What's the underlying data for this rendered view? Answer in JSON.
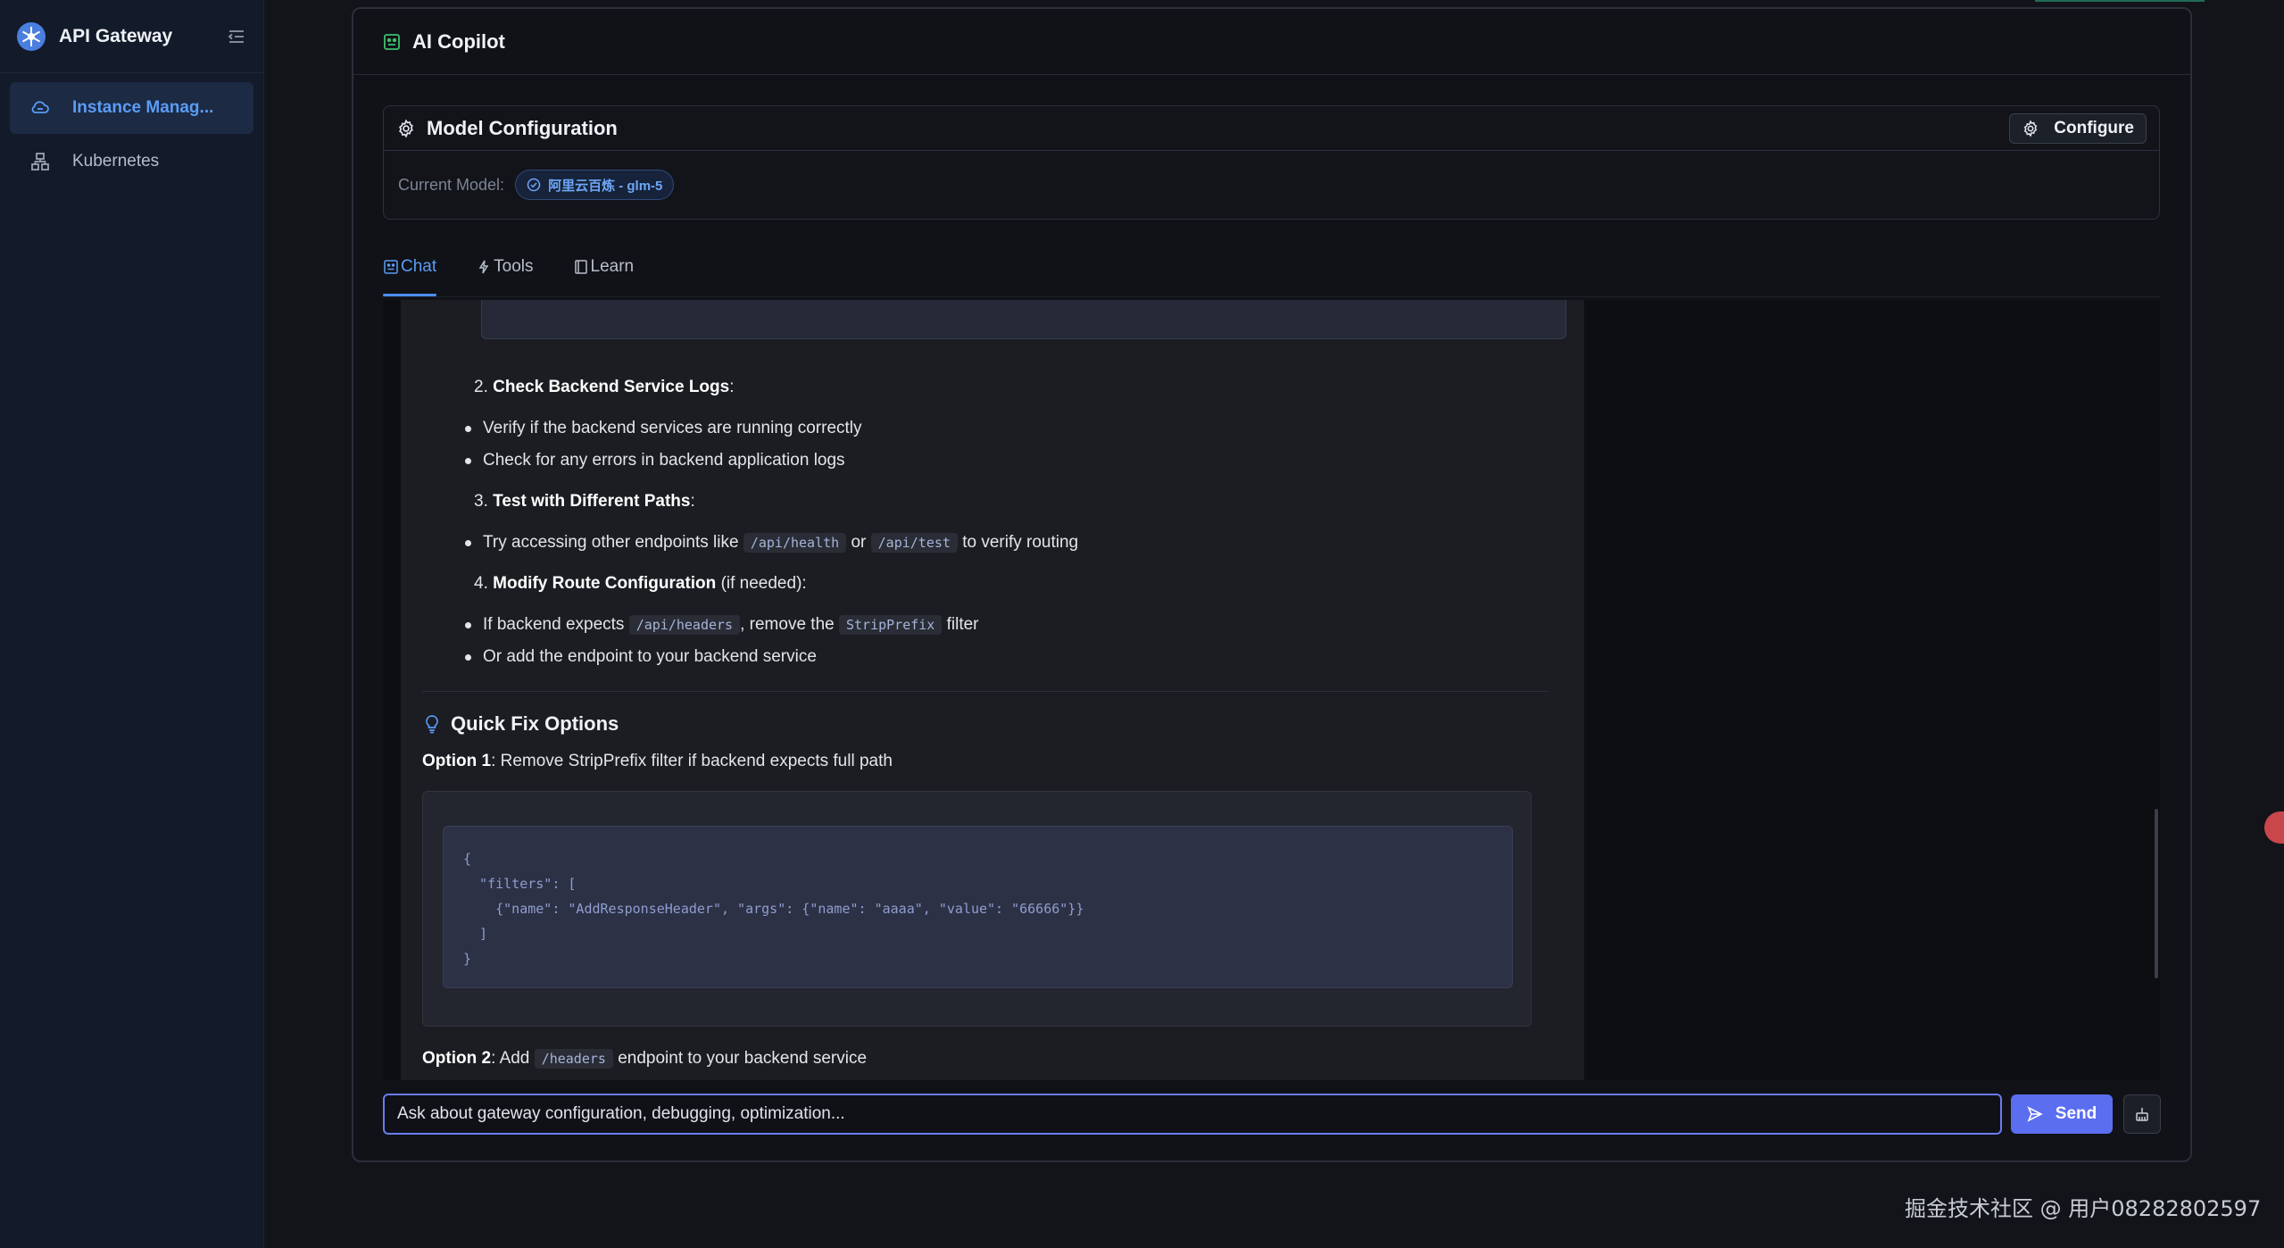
{
  "sidebar": {
    "brand": "API Gateway",
    "items": [
      {
        "label": "Instance Manag...",
        "active": true
      },
      {
        "label": "Kubernetes",
        "active": false
      }
    ]
  },
  "panel": {
    "title": "AI Copilot"
  },
  "model_config": {
    "title": "Model Configuration",
    "configure_label": "Configure",
    "current_label": "Current Model:",
    "current_model": "阿里云百炼 - glm-5"
  },
  "tabs": [
    {
      "label": "Chat",
      "active": true
    },
    {
      "label": "Tools",
      "active": false
    },
    {
      "label": "Learn",
      "active": false
    }
  ],
  "message": {
    "step2": {
      "num": "2.",
      "title": "Check Backend Service Logs",
      "suffix": ":"
    },
    "step2_bullets": [
      "Verify if the backend services are running correctly",
      "Check for any errors in backend application logs"
    ],
    "step3": {
      "num": "3.",
      "title": "Test with Different Paths",
      "suffix": ":"
    },
    "step3_bullet": {
      "pre": "Try accessing other endpoints like",
      "code1": "/api/health",
      "mid": "or",
      "code2": "/api/test",
      "post": "to verify routing"
    },
    "step4": {
      "num": "4.",
      "title": "Modify Route Configuration",
      "suffix": "(if needed):"
    },
    "step4_bullet1": {
      "pre": "If backend expects",
      "code1": "/api/headers",
      "mid": ", remove the",
      "code2": "StripPrefix",
      "post": "filter"
    },
    "step4_bullet2": "Or add the endpoint to your backend service",
    "quick_fix_title": "Quick Fix Options",
    "option1": {
      "label": "Option 1",
      "text": ": Remove StripPrefix filter if backend expects full path"
    },
    "code_lines": [
      "{",
      "  \"filters\": [",
      "    {\"name\": \"AddResponseHeader\", \"args\": {\"name\": \"aaaa\", \"value\": \"66666\"}}",
      "  ]",
      "}"
    ],
    "option2": {
      "label": "Option 2",
      "pre": ": Add",
      "code": "/headers",
      "post": "endpoint to your backend service"
    }
  },
  "input": {
    "placeholder": "Ask about gateway configuration, debugging, optimization..."
  },
  "send_label": "Send",
  "watermark": "掘金技术社区 @ 用户08282802597",
  "colors": {
    "accent": "#5b6ef0",
    "active_nav": "#5b9cf5",
    "background": "#12141a"
  }
}
